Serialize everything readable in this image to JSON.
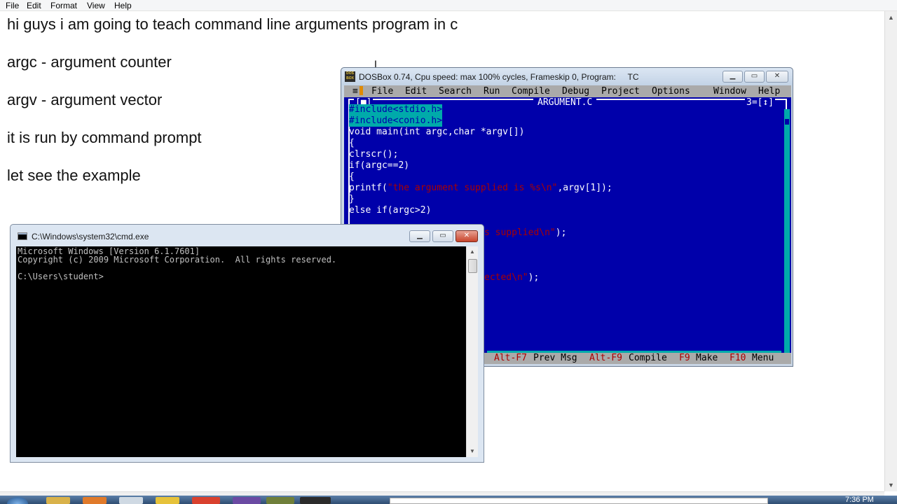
{
  "notepad": {
    "menu": [
      "File",
      "Edit",
      "Format",
      "View",
      "Help"
    ],
    "lines": [
      "hi guys i am going to teach command line arguments program in c",
      "argc - argument counter",
      "argv - argument vector",
      "it is run by command prompt",
      "let see the example"
    ]
  },
  "dosbox": {
    "title": "DOSBox 0.74, Cpu speed: max 100% cycles, Frameskip 0, Program:",
    "program": "TC",
    "icon_label": "DOS BOX",
    "menu": {
      "system": "≡",
      "items": [
        "File",
        "Edit",
        "Search",
        "Run",
        "Compile",
        "Debug",
        "Project",
        "Options",
        "Window",
        "Help"
      ]
    },
    "editor": {
      "filename": "ARGUMENT.C",
      "window_number": "3=[↕]",
      "close_box": "[■]",
      "code": {
        "l1": "#include<stdio.h>",
        "l2": "#include<conio.h>",
        "l3": "void main(int argc,char *argv[])",
        "l4": "{",
        "l5": "clrscr();",
        "l6": "if(argc==2)",
        "l7": "{",
        "l8_fn": "printf(",
        "l8_str": "\"the argument supplied is %s\\n\"",
        "l8_rest": ",argv[1]);",
        "l9": "}",
        "l10": "else if(argc>2)",
        "l12_str": "s supplied\\n\"",
        "l12_rest": ");",
        "l16_str": "ected\\n\"",
        "l16_rest": ");"
      }
    },
    "status": [
      {
        "key": "Alt-F7",
        "label": "Prev Msg"
      },
      {
        "key": "Alt-F9",
        "label": "Compile"
      },
      {
        "key": "F9",
        "label": "Make"
      },
      {
        "key": "F10",
        "label": "Menu"
      }
    ]
  },
  "cmd": {
    "title": "C:\\Windows\\system32\\cmd.exe",
    "lines": [
      "Microsoft Windows [Version 6.1.7601]",
      "Copyright (c) 2009 Microsoft Corporation.  All rights reserved.",
      "",
      "C:\\Users\\student>"
    ]
  },
  "taskbar": {
    "clock": "7:36 PM"
  },
  "colors": {
    "dos_blue": "#0000aa",
    "dos_gray": "#aaaaaa",
    "dos_red": "#aa0000",
    "dos_cyan": "#00aaaa"
  }
}
